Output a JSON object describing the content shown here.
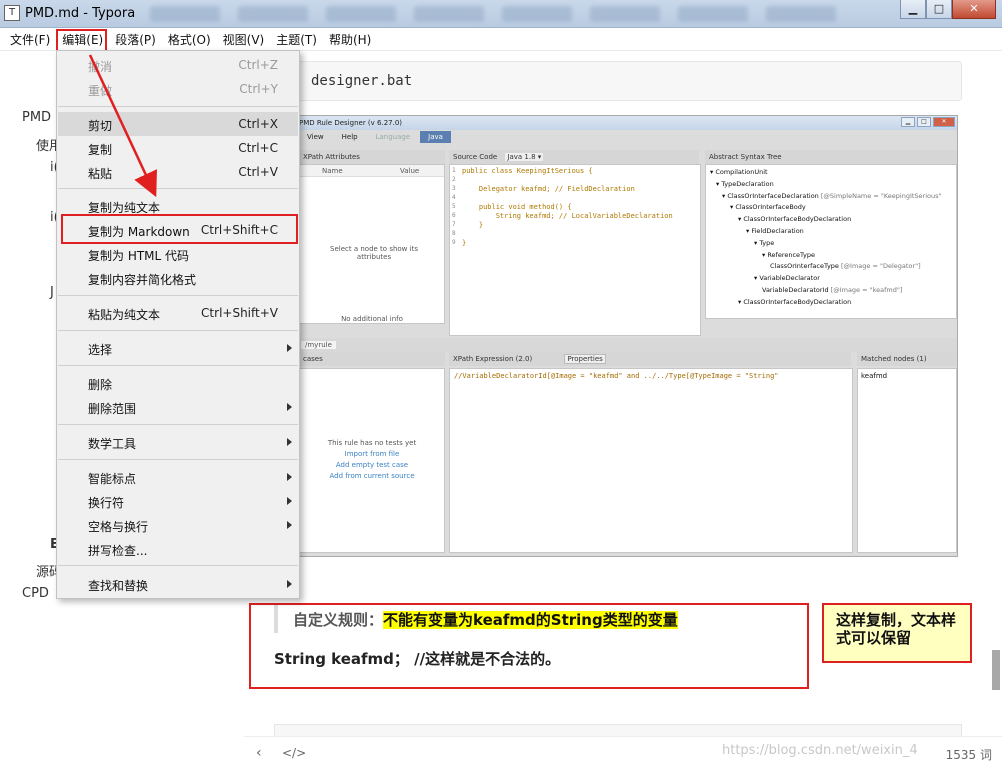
{
  "window": {
    "title": "PMD.md - Typora",
    "app_icon": "T"
  },
  "menubar": [
    "文件(F)",
    "编辑(E)",
    "段落(P)",
    "格式(O)",
    "视图(V)",
    "主题(T)",
    "帮助(H)"
  ],
  "behind_menu_text": [
    "PMD",
    "使用",
    "i(",
    "i(",
    "J",
    "E",
    "源码",
    "CPD"
  ],
  "edit_menu": {
    "undo": {
      "label": "撤消",
      "shortcut": "Ctrl+Z"
    },
    "redo": {
      "label": "重做",
      "shortcut": "Ctrl+Y"
    },
    "cut": {
      "label": "剪切",
      "shortcut": "Ctrl+X"
    },
    "copy": {
      "label": "复制",
      "shortcut": "Ctrl+C"
    },
    "paste": {
      "label": "粘贴",
      "shortcut": "Ctrl+V"
    },
    "copy_plain": {
      "label": "复制为纯文本"
    },
    "copy_markdown": {
      "label": "复制为 Markdown",
      "shortcut": "Ctrl+Shift+C"
    },
    "copy_html": {
      "label": "复制为 HTML 代码"
    },
    "copy_simplified": {
      "label": "复制内容并简化格式"
    },
    "paste_plain": {
      "label": "粘贴为纯文本",
      "shortcut": "Ctrl+Shift+V"
    },
    "select": {
      "label": "选择"
    },
    "delete": {
      "label": "删除"
    },
    "delete_range": {
      "label": "删除范围"
    },
    "math_tools": {
      "label": "数学工具"
    },
    "smart_punct": {
      "label": "智能标点"
    },
    "line_break": {
      "label": "换行符"
    },
    "spaces": {
      "label": "空格与换行"
    },
    "spellcheck": {
      "label": "拼写检查..."
    },
    "find_replace": {
      "label": "查找和替换"
    }
  },
  "document": {
    "code": "designer.bat",
    "quote_prefix": "自定义规则：",
    "quote_highlight": "不能有变量为keafmd的String类型的变量",
    "para": "String keafmd；  //这样就是不合法的。",
    "note": "这样复制，文本样式可以保留"
  },
  "embedded_shot": {
    "title": "PMD Rule Designer (v 6.27.0)",
    "menus": [
      "View",
      "Help",
      "Language",
      "Java"
    ],
    "xpath_attributes": "XPath Attributes",
    "col_name": "Name",
    "col_value": "Value",
    "select_node_msg": "Select a node to show its attributes",
    "no_info": "No additional info",
    "source_code": "Source Code",
    "java_version": "Java 1.8 ▾",
    "ast_title": "Abstract Syntax Tree",
    "source_lines": [
      "public class KeepingItSerious {",
      "",
      "    Delegator keafmd; // FieldDeclaration",
      "",
      "    public void method() {",
      "        String keafmd; // LocalVariableDeclaration",
      "    }",
      "",
      "}"
    ],
    "ast_lines": [
      "▾ CompilationUnit",
      "▾ TypeDeclaration",
      "▾ ClassOrInterfaceDeclaration",
      "▾ ClassOrInterfaceBody",
      "▾ ClassOrInterfaceBodyDeclaration",
      "▾ FieldDeclaration",
      "▾ Type",
      "▾ ReferenceType",
      "ClassOrInterfaceType",
      "▾ VariableDeclarator",
      "VariableDeclaratorId",
      "▾ ClassOrInterfaceBodyDeclaration"
    ],
    "ast_attrs": [
      "",
      "",
      "[@SimpleName = \"KeepingItSerious\"",
      "",
      "",
      "",
      "",
      "",
      "[@Image = \"Delegator\"]",
      "",
      "[@Image = \"keafmd\"]",
      ""
    ],
    "rule_tab": "/myrule",
    "cases": "cases",
    "xpath_expr": "XPath Expression (2.0)",
    "properties": "Properties",
    "matched_nodes": "Matched nodes (1)",
    "matched_item": "keafmd",
    "no_tests": "This rule has no tests yet",
    "import_file": "Import from file",
    "add_empty": "Add empty test case",
    "add_current": "Add from current source",
    "xpath_text": "//VariableDeclaratorId[@Image = \"keafmd\" and ../../Type[@TypeImage = \"String\""
  },
  "statusbar": {
    "back_icon": "chevron-left-icon",
    "source_icon": "code-icon",
    "wordcount": "1535 词"
  },
  "watermark": "https://blog.csdn.net/weixin_4"
}
